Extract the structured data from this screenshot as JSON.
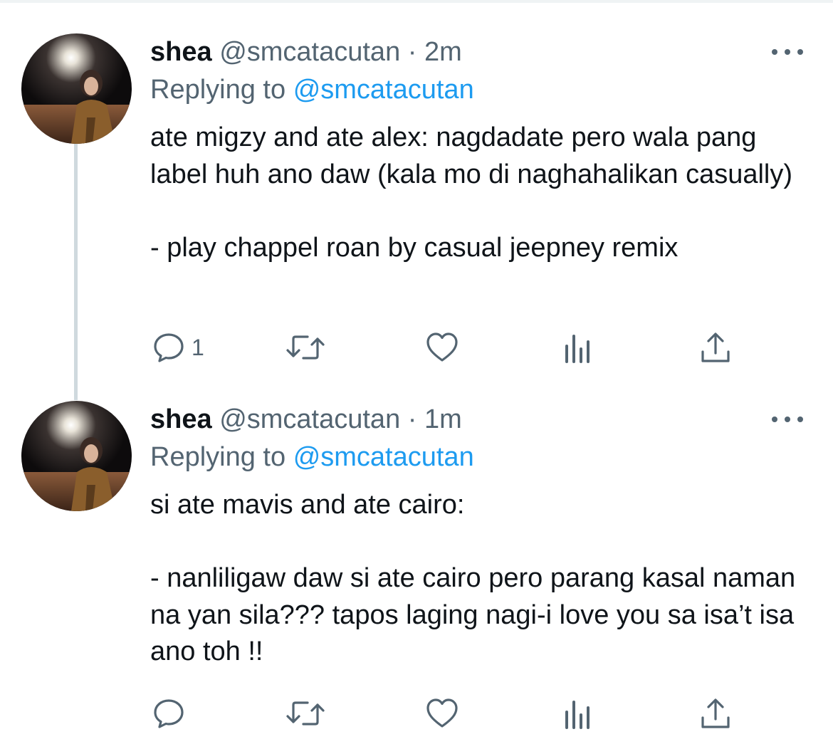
{
  "tweets": [
    {
      "name": "shea",
      "handle": "@smcatacutan",
      "separator": "·",
      "time": "2m",
      "replying_prefix": "Replying to",
      "replying_to": "@smcatacutan",
      "body": [
        "ate migzy and ate alex: nagdadate pero wala pang label huh ano daw (kala mo di naghahalikan casually)",
        "",
        "- play chappel roan by casual jeepney remix"
      ],
      "reply_count": "1",
      "icons": [
        "reply-icon",
        "retweet-icon",
        "like-icon",
        "analytics-icon",
        "share-icon"
      ]
    },
    {
      "name": "shea",
      "handle": "@smcatacutan",
      "separator": "·",
      "time": "1m",
      "replying_prefix": "Replying to",
      "replying_to": "@smcatacutan",
      "body": [
        "si ate mavis and ate cairo:",
        "",
        "- nanliligaw daw si ate cairo pero parang kasal naman na yan sila??? tapos laging nagi-i love you sa isa’t isa ano toh !!"
      ],
      "reply_count": "",
      "icons": [
        "reply-icon",
        "retweet-icon",
        "like-icon",
        "analytics-icon",
        "share-icon"
      ]
    }
  ],
  "colors": {
    "text": "#0f1419",
    "secondary": "#536471",
    "link": "#1d9bf0",
    "thread_line": "#cfd9de"
  }
}
